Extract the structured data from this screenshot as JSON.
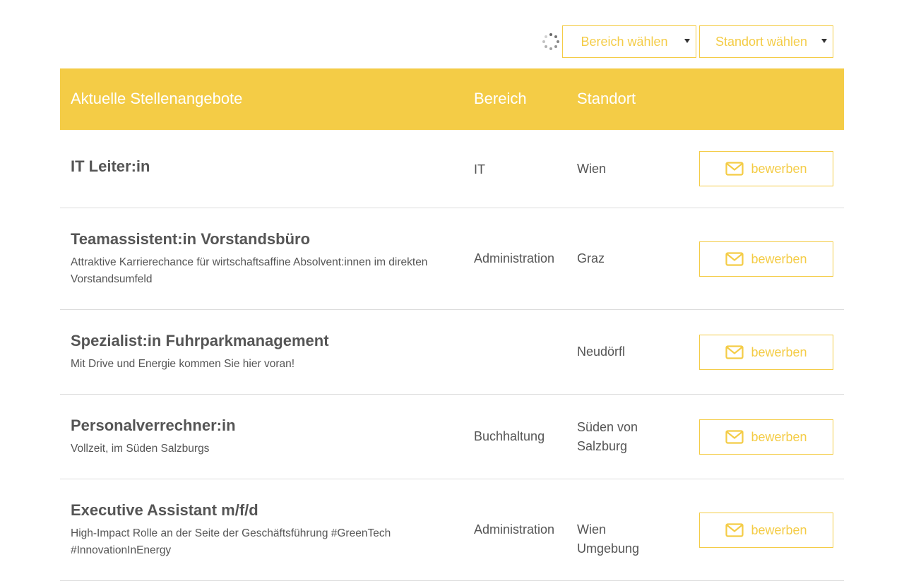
{
  "filters": {
    "bereich_placeholder": "Bereich wählen",
    "standort_placeholder": "Standort wählen"
  },
  "colors": {
    "accent": "#f4cc46",
    "text": "#555555",
    "divider": "#dcdcdc"
  },
  "table": {
    "headers": [
      "Aktuelle Stellenangebote",
      "Bereich",
      "Standort"
    ],
    "rows": [
      {
        "title": "IT Leiter:in",
        "description": "",
        "bereich": "IT",
        "standort": "Wien",
        "button": "bewerben"
      },
      {
        "title": "Teamassistent:in Vorstandsbüro",
        "description": "Attraktive Karrierechance für wirtschaftsaffine Absolvent:innen im direkten Vorstandsumfeld",
        "bereich": "Administration",
        "standort": "Graz",
        "button": "bewerben"
      },
      {
        "title": "Spezialist:in Fuhrparkmanagement",
        "description": "Mit Drive und Energie kommen Sie hier voran!",
        "bereich": "",
        "standort": "Neudörfl",
        "button": "bewerben"
      },
      {
        "title": "Personalverrechner:in",
        "description": "Vollzeit, im Süden Salzburgs",
        "bereich": "Buchhaltung",
        "standort": "Süden von Salzburg",
        "button": "bewerben"
      },
      {
        "title": "Executive Assistant m/f/d",
        "description": "High-Impact Rolle an der Seite der Geschäftsführung #GreenTech #InnovationInEnergy",
        "bereich": "Administration",
        "standort": "Wien Umgebung",
        "button": "bewerben"
      }
    ]
  },
  "icons": {
    "spinner": "loading-spinner-icon",
    "apply": "envelope-icon"
  }
}
